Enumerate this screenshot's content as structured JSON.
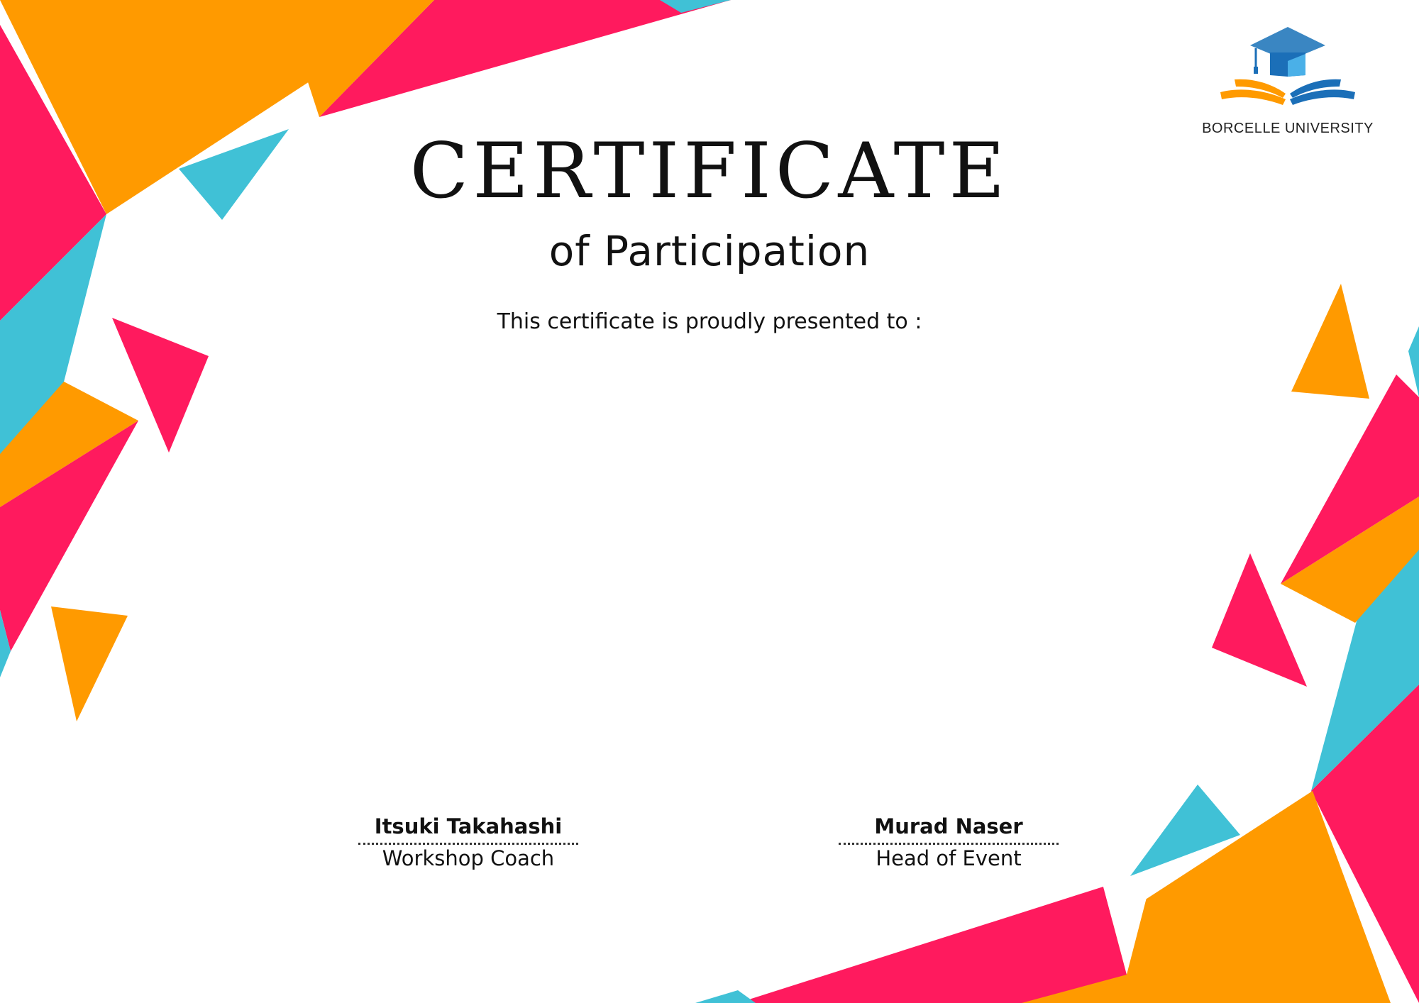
{
  "certificate": {
    "title": "CERTIFICATE",
    "subtitle": "of Participation",
    "presented_text": "This certificate is proudly presented to :"
  },
  "logo": {
    "icon": "graduation-cap-book-icon",
    "institution": "BORCELLE UNIVERSITY"
  },
  "signatories": [
    {
      "name": "Itsuki Takahashi",
      "role": "Workshop Coach"
    },
    {
      "name": "Murad Naser",
      "role": "Head of Event"
    }
  ],
  "colors": {
    "pink": "#FF1A5E",
    "orange": "#FF9A00",
    "cyan": "#40C1D6",
    "logo_blue": "#1B6FB8",
    "logo_light_blue": "#4AB0E8"
  }
}
